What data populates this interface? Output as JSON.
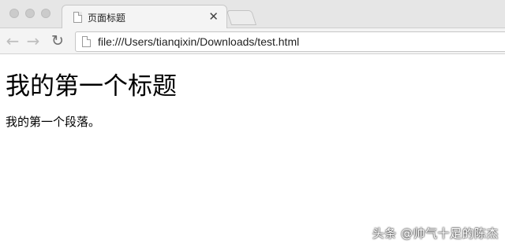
{
  "browser": {
    "tab": {
      "title": "页面标题",
      "close_glyph": "✕"
    },
    "toolbar": {
      "back_icon": "←",
      "forward_icon": "→",
      "reload_icon": "↻",
      "url": "file:///Users/tianqixin/Downloads/test.html"
    }
  },
  "page": {
    "heading": "我的第一个标题",
    "paragraph": "我的第一个段落。"
  },
  "watermark": "头条 @帅气十足的陈杰"
}
